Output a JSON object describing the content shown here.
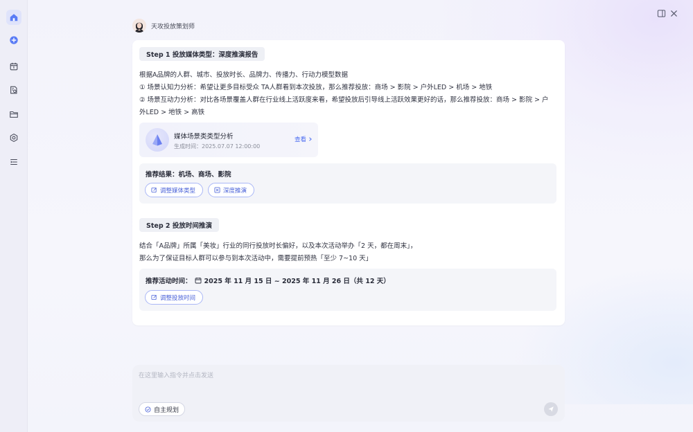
{
  "agent": {
    "name": "天攻投放策划师"
  },
  "step1": {
    "title": "Step 1  投放媒体类型：深度推演报告",
    "lines": [
      "根据A品牌的人群、城市、投放时长、品牌力、传播力、行动力模型数据",
      "① 场景认知力分析：希望让更多目标受众 TA人群看到本次投放，那么推荐投放：商场 > 影院 > 户外LED > 机场 > 地铁",
      "② 场景互动力分析：对比各场景覆盖人群在行业线上活跃度来看，希望投放后引导线上活跃效果更好的话，那么推荐投放：商场 > 影院 > 户",
      "外LED > 地铁 > 高铁"
    ],
    "analysis_card": {
      "title": "媒体场景类类型分析",
      "time": "生成时间：2025.07.07 12:00:00",
      "view_label": "查看"
    },
    "result": {
      "label": "推荐结果：机场、商场、影院",
      "buttons": [
        "调整媒体类型",
        "深度推演"
      ]
    }
  },
  "step2": {
    "title": "Step 2  投放时间推演",
    "lines": [
      "结合「A品牌」所属「美妆」行业的同行投放时长偏好，以及本次活动举办「2 天，都在周末」，",
      "那么为了保证目标人群可以参与到本次活动中，需要提前预热「至少 7~10 天」"
    ],
    "result": {
      "label": "推荐活动时间：",
      "value": "2025 年 11 月 15 日 ~ 2025 年 11 月 26 日（共 12 天）",
      "button": "调整投放时间"
    }
  },
  "input": {
    "placeholder": "在这里输入指令并点击发送",
    "mode_label": "自主规划"
  },
  "colors": {
    "accent": "#4a62d8",
    "sidebar_active": "#dfe3fb"
  }
}
